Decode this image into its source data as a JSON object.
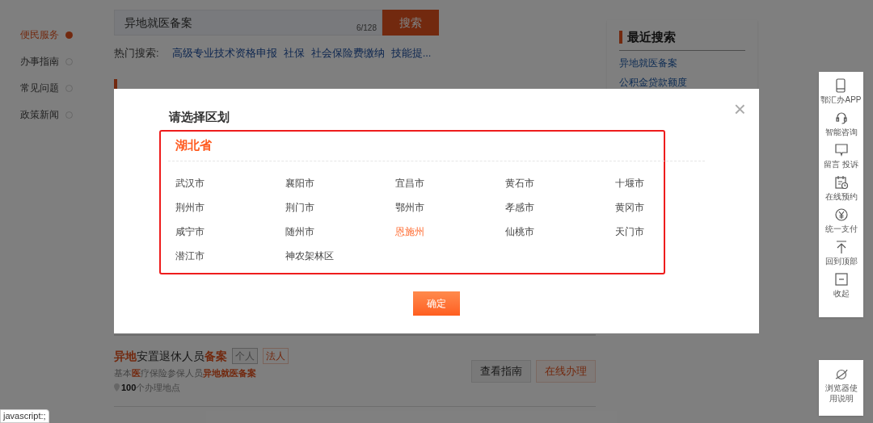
{
  "side_nav": [
    {
      "label": "便民服务",
      "selected": true
    },
    {
      "label": "办事指南",
      "selected": false
    },
    {
      "label": "常见问题",
      "selected": false
    },
    {
      "label": "政策新闻",
      "selected": false
    }
  ],
  "search": {
    "value": "异地就医备案",
    "counter": "6/128",
    "button": "搜索"
  },
  "hot_search": {
    "label": "热门搜索:",
    "links": [
      "高级专业技术资格申报",
      "社保",
      "社会保险费缴纳",
      "技能提..."
    ]
  },
  "recent_search": {
    "title": "最近搜索",
    "links": [
      "异地就医备案",
      "公积金贷款额度"
    ]
  },
  "result_item": {
    "title": "**异地**安置退休人员**备案**",
    "tags": [
      "个人",
      "法人"
    ],
    "description": "基本**医**疗保险参保人员**异地就医备案**",
    "locations": "**100**个办理地点",
    "buttons": [
      {
        "label": "查看指南",
        "kind": "plain"
      },
      {
        "label": "在线办理",
        "kind": "accent"
      }
    ]
  },
  "dialog": {
    "title": "请选择区划",
    "close": "×",
    "province": "湖北省",
    "cities": [
      {
        "name": "武汉市",
        "selected": false
      },
      {
        "name": "襄阳市",
        "selected": false
      },
      {
        "name": "宜昌市",
        "selected": false
      },
      {
        "name": "黄石市",
        "selected": false
      },
      {
        "name": "十堰市",
        "selected": false
      },
      {
        "name": "荆州市",
        "selected": false
      },
      {
        "name": "荆门市",
        "selected": false
      },
      {
        "name": "鄂州市",
        "selected": false
      },
      {
        "name": "孝感市",
        "selected": false
      },
      {
        "name": "黄冈市",
        "selected": false
      },
      {
        "name": "咸宁市",
        "selected": false
      },
      {
        "name": "随州市",
        "selected": false
      },
      {
        "name": "恩施州",
        "selected": true
      },
      {
        "name": "仙桃市",
        "selected": false
      },
      {
        "name": "天门市",
        "selected": false
      },
      {
        "name": "潜江市",
        "selected": false
      },
      {
        "name": "神农架林区",
        "selected": false
      }
    ],
    "confirm": "确定"
  },
  "toolbar": [
    {
      "label": "鄂汇办APP",
      "kind": "phone"
    },
    {
      "label": "智能咨询",
      "kind": "headset"
    },
    {
      "label": "留言 投诉",
      "kind": "chat"
    },
    {
      "label": "在线预约",
      "kind": "calendar"
    },
    {
      "label": "统一支付",
      "kind": "yen"
    },
    {
      "label": "回到顶部",
      "kind": "top"
    },
    {
      "label": "收起",
      "kind": "collapse"
    }
  ],
  "browser_help": {
    "label": "浏览器使用说明"
  },
  "status_bar": "javascript:;"
}
